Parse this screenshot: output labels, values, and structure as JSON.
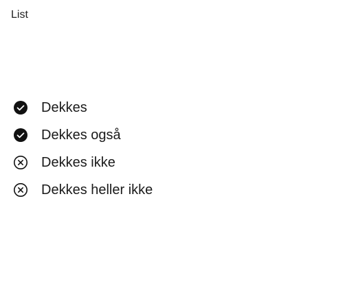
{
  "title": "List",
  "items": [
    {
      "label": "Dekkes",
      "icon": "check-circle-filled-icon"
    },
    {
      "label": "Dekkes også",
      "icon": "check-circle-filled-icon"
    },
    {
      "label": "Dekkes ikke",
      "icon": "x-circle-outline-icon"
    },
    {
      "label": "Dekkes heller ikke",
      "icon": "x-circle-outline-icon"
    }
  ]
}
